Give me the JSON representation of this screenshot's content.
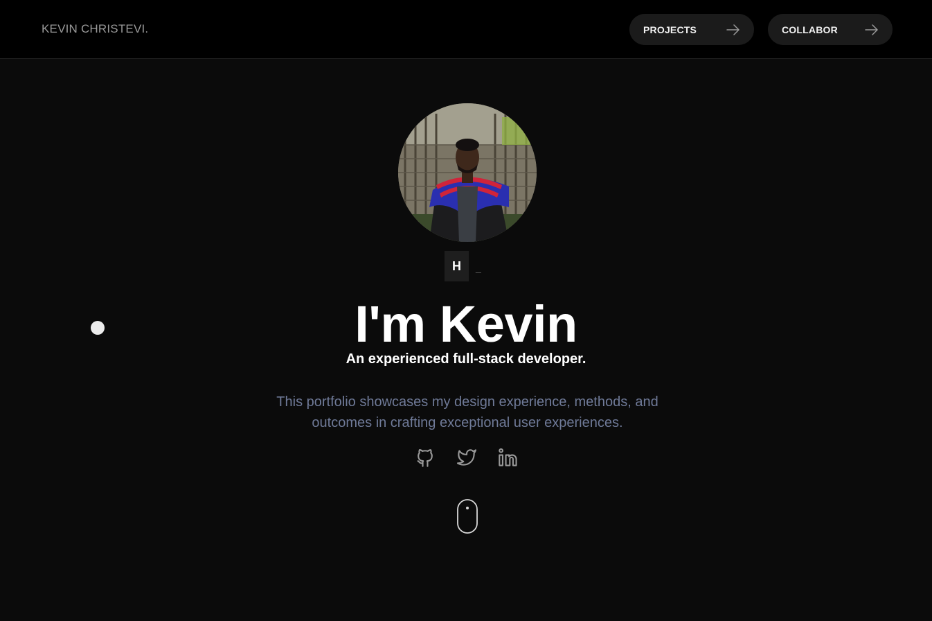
{
  "header": {
    "brand": "KEVIN CHRISTEVI.",
    "nav": [
      {
        "label": "PROJECTS",
        "icon": "arrow-right-icon"
      },
      {
        "label": "COLLABOR",
        "icon": "arrow-right-icon"
      }
    ]
  },
  "hero": {
    "typed_letter": "H",
    "typed_cursor": "_",
    "headline": "I'm Kevin",
    "subheadline": "An experienced full-stack developer.",
    "description": "This portfolio showcases my design experience, methods, and outcomes in crafting exceptional user experiences.",
    "socials": [
      {
        "icon": "github-icon"
      },
      {
        "icon": "twitter-icon"
      },
      {
        "icon": "linkedin-icon"
      }
    ],
    "scroll_indicator": "mouse-scroll-icon"
  },
  "colors": {
    "background": "#0b0b0b",
    "header_background": "#000000",
    "button_background": "#1b1b1b",
    "description_text": "#6f7a98"
  }
}
